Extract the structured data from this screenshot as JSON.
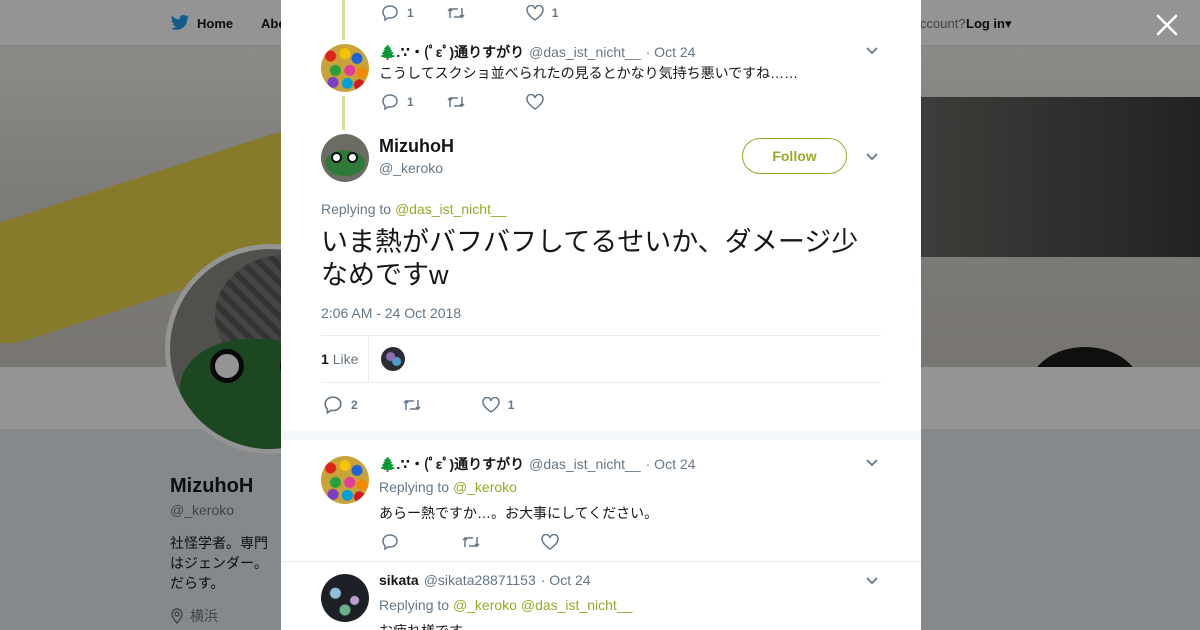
{
  "nav": {
    "home": "Home",
    "about": "Abo",
    "account": "ccount?",
    "login": "Log in"
  },
  "profile": {
    "name": "MizuhoH",
    "handle": "@_keroko",
    "bio": "社怪学者。専門はジェンダー。だらす。",
    "location": "横浜"
  },
  "tweets": {
    "top": {
      "replies": "1",
      "likes": "1"
    },
    "t1": {
      "name": "🌲.∵・(ﾟεﾟ)通りすがり",
      "handle": "@das_ist_nicht__",
      "date": "· Oct 24",
      "text": "こうしてスクショ並べられたの見るとかなり気持ち悪いですね……",
      "replies": "1"
    },
    "main": {
      "name": "MizuhoH",
      "handle": "@_keroko",
      "follow": "Follow",
      "replying_label": "Replying to",
      "replying_to": "@das_ist_nicht__",
      "text": "いま熱がバフバフしてるせいか、ダメージ少なめですw",
      "timestamp": "2:06 AM - 24 Oct 2018",
      "like_count": "1",
      "like_label": "Like",
      "replies": "2",
      "likes": "1"
    },
    "r1": {
      "name": "🌲.∵・(ﾟεﾟ)通りすがり",
      "handle": "@das_ist_nicht__",
      "date": "· Oct 24",
      "replying_label": "Replying to",
      "replying_to": "@_keroko",
      "text": "あらー熱ですか…。お大事にしてください。"
    },
    "r2": {
      "name": "sikata",
      "handle": "@sikata28871153",
      "date": "· Oct 24",
      "replying_label": "Replying to",
      "replying_to_1": "@_keroko",
      "replying_to_2": "@das_ist_nicht__",
      "text": "お疲れ様です"
    }
  },
  "colors": {
    "accent": "#9aa82a",
    "muted": "#657786",
    "thread": "#d9df9d"
  }
}
